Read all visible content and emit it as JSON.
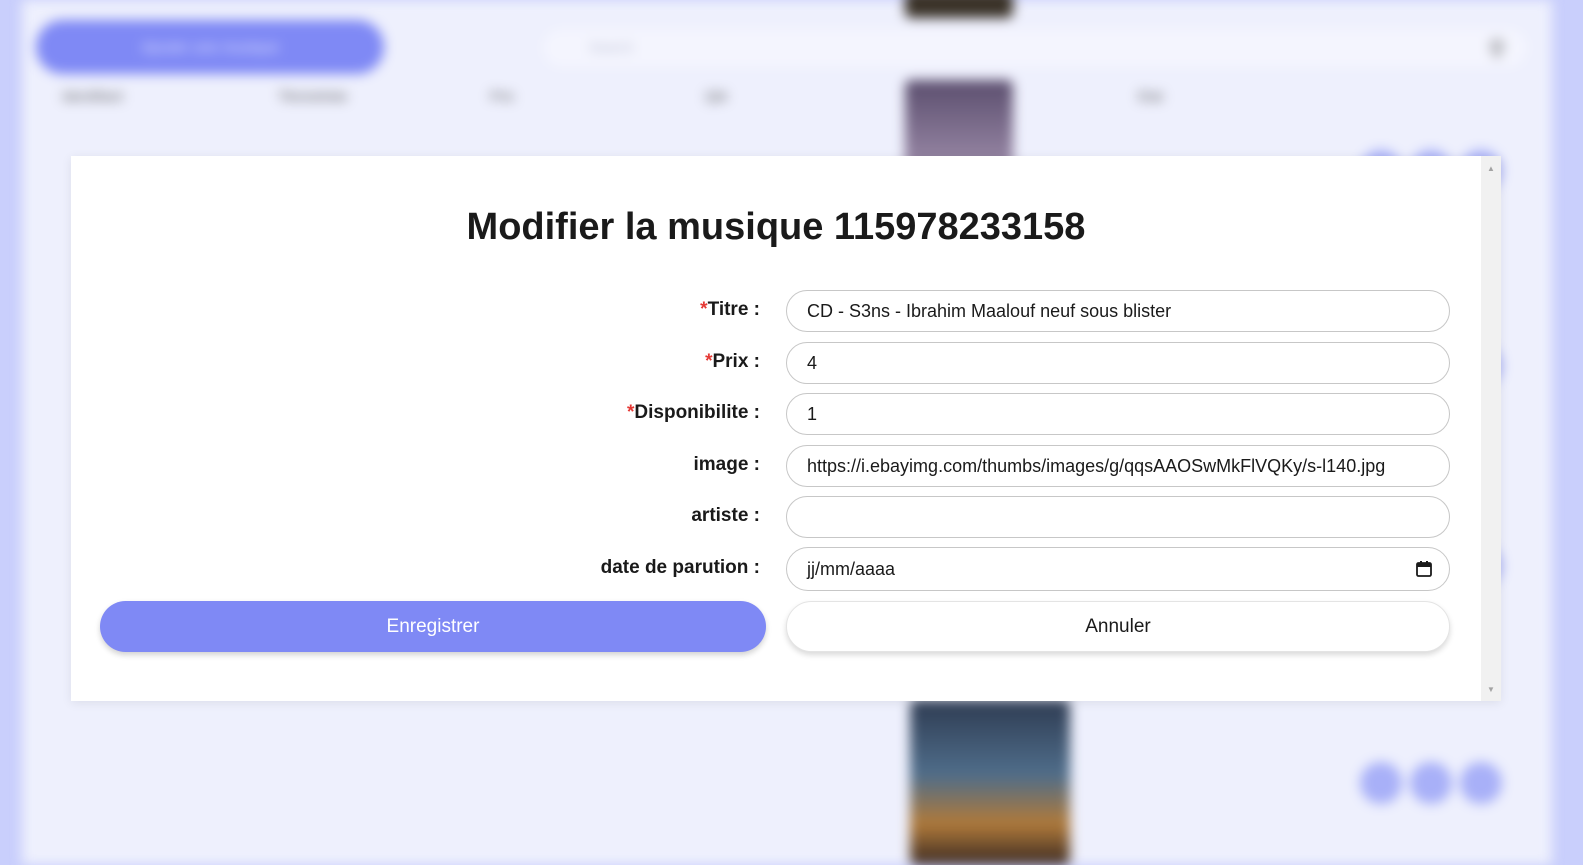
{
  "background": {
    "add_button_label": "Ajouter une musique",
    "search_placeholder": "Search",
    "columns": [
      "Identifiant",
      "Titre/artiste",
      "Prix",
      "Qté",
      "Etat"
    ]
  },
  "modal": {
    "title": "Modifier la musique 115978233158",
    "required_marker": "*",
    "fields": {
      "titre": {
        "label": "Titre :",
        "value": "CD - S3ns - Ibrahim Maalouf neuf sous blister"
      },
      "prix": {
        "label": "Prix :",
        "value": "4"
      },
      "disponibilite": {
        "label": "Disponibilite :",
        "value": "1"
      },
      "image": {
        "label": "image :",
        "value": "https://i.ebayimg.com/thumbs/images/g/qqsAAOSwMkFlVQKy/s-l140.jpg"
      },
      "artiste": {
        "label": "artiste :",
        "value": ""
      },
      "date_parution": {
        "label": "date de parution :",
        "placeholder": "jj/mm/aaaa"
      }
    },
    "save_label": "Enregistrer",
    "cancel_label": "Annuler"
  },
  "colors": {
    "accent": "#7f89f5",
    "required": "#e53935",
    "backdrop": "#c9cffc"
  }
}
